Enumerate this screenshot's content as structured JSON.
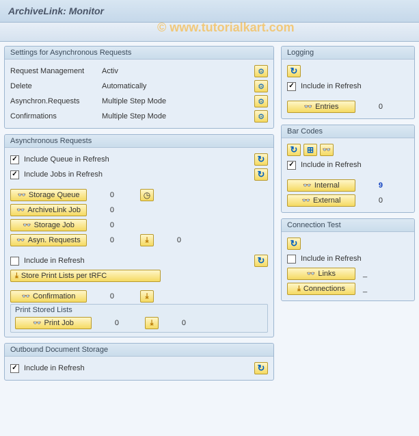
{
  "header": {
    "title": "ArchiveLink: Monitor"
  },
  "watermark": "© www.tutorialkart.com",
  "settings": {
    "title": "Settings for Asynchronous Requests",
    "rows": [
      {
        "label": "Request Management",
        "value": "Activ"
      },
      {
        "label": "Delete",
        "value": "Automatically"
      },
      {
        "label": "Asynchron.Requests",
        "value": "Multiple Step Mode"
      },
      {
        "label": "Confirmations",
        "value": "Multiple Step Mode"
      }
    ]
  },
  "async": {
    "title": "Asynchronous Requests",
    "chk_queue": "Include Queue in Refresh",
    "chk_jobs": "Include Jobs in Refresh",
    "btn_storage_queue": "Storage Queue",
    "btn_archivelink_job": "ArchiveLink Job",
    "btn_storage_job": "Storage Job",
    "btn_asyn_requests": "Asyn. Requests",
    "cnt_storage_queue": "0",
    "cnt_archivelink_job": "0",
    "cnt_storage_job": "0",
    "cnt_asyn_requests": "0",
    "cnt_asyn_requests2": "0",
    "chk_include": "Include in Refresh",
    "btn_store_print": "Store Print Lists per tRFC",
    "btn_confirmation": "Confirmation",
    "cnt_confirmation": "0",
    "print_stored_title": "Print Stored Lists",
    "btn_print_job": "Print Job",
    "cnt_print_job": "0",
    "cnt_print_job2": "0"
  },
  "outbound": {
    "title": "Outbound Document Storage",
    "chk_include": "Include in Refresh"
  },
  "logging": {
    "title": "Logging",
    "chk_include": "Include in Refresh",
    "btn_entries": "Entries",
    "cnt_entries": "0"
  },
  "barcodes": {
    "title": "Bar Codes",
    "chk_include": "Include in Refresh",
    "btn_internal": "Internal",
    "btn_external": "External",
    "cnt_internal": "9",
    "cnt_external": "0"
  },
  "conntest": {
    "title": "Connection Test",
    "chk_include": "Include in Refresh",
    "btn_links": "Links",
    "btn_connections": "Connections",
    "dash": "_"
  }
}
